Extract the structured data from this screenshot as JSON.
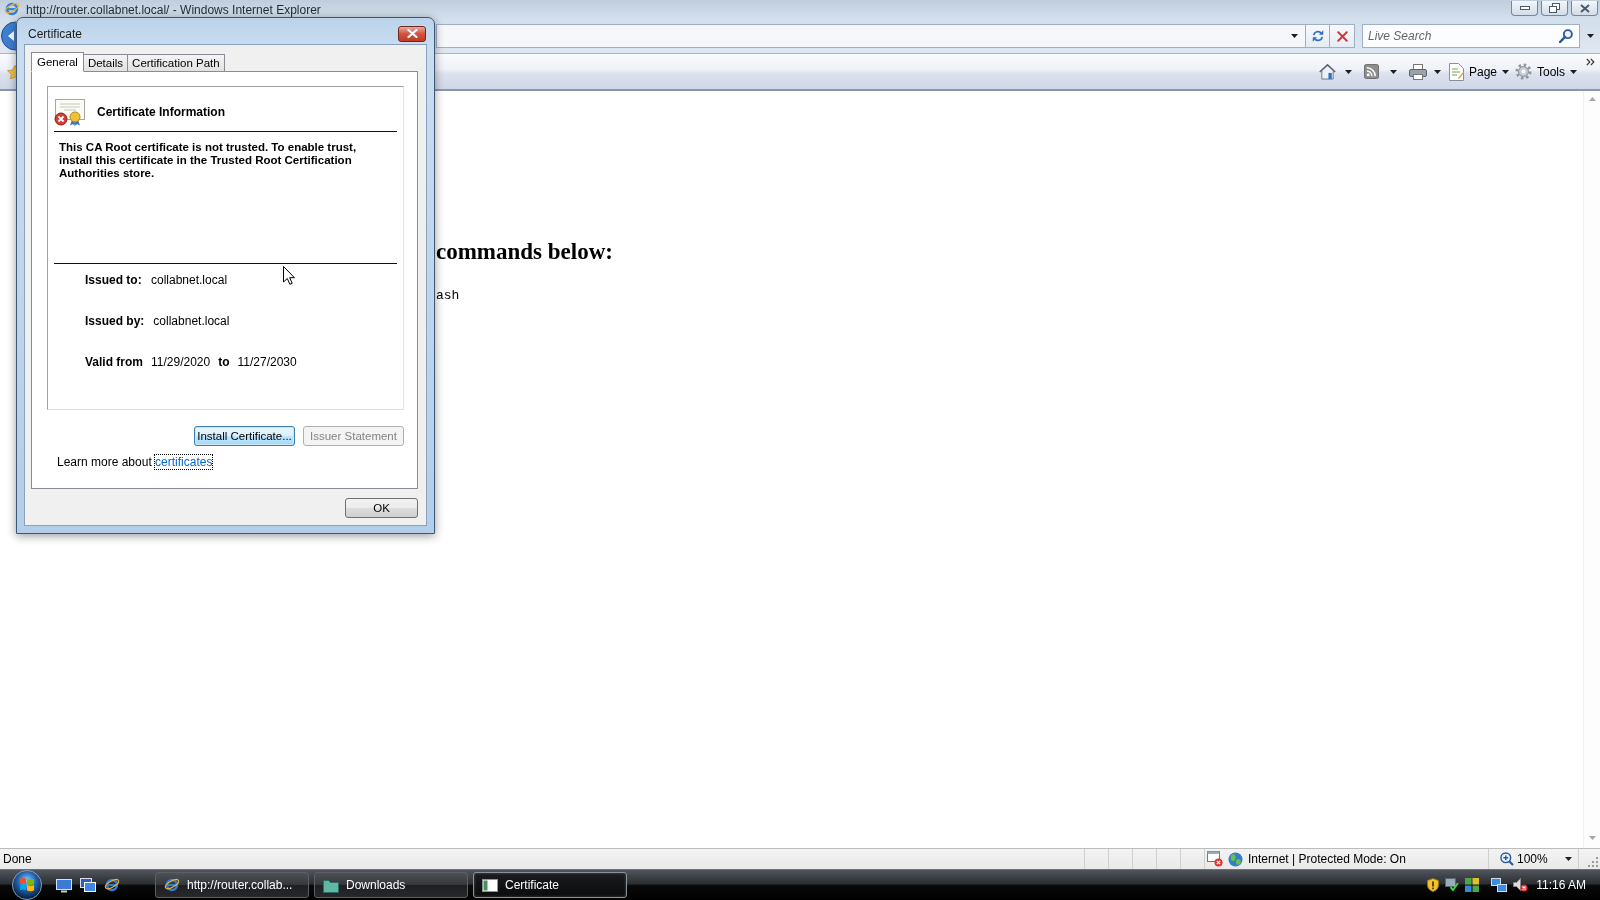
{
  "browser": {
    "title": "http://router.collabnet.local/ - Windows Internet Explorer",
    "search": {
      "placeholder": "Live Search"
    },
    "menus": [
      {
        "kind": "page",
        "label": "Page"
      },
      {
        "kind": "tools",
        "label": "Tools"
      }
    ],
    "page": {
      "heading": "commands below:",
      "code": "ash"
    },
    "status_bar": {
      "text": "Done",
      "zone": "Internet | Protected Mode: On",
      "zoom": "100%"
    }
  },
  "dialog": {
    "title": "Certificate",
    "tabs": [
      {
        "label": "General",
        "selected": true
      },
      {
        "label": "Details",
        "selected": false
      },
      {
        "label": "Certification Path",
        "selected": false
      }
    ],
    "heading": "Certificate Information",
    "message": "This CA Root certificate is not trusted. To enable trust, install this certificate in the Trusted Root Certification Authorities store.",
    "fields": [
      {
        "label": "Issued to:",
        "value": "collabnet.local"
      },
      {
        "label": "Issued by:",
        "value": "collabnet.local"
      }
    ],
    "validity": {
      "label": "Valid from",
      "from": "11/29/2020",
      "separator": "to",
      "to": "11/27/2030"
    },
    "buttons": [
      {
        "label": "Install Certificate...",
        "default": true,
        "disabled": false
      },
      {
        "label": "Issuer Statement",
        "default": false,
        "disabled": true
      }
    ],
    "learn_more": {
      "text": "Learn more about",
      "link": "certificates",
      "focused": true
    },
    "ok_button": "OK"
  },
  "taskbar": {
    "tasks": [
      {
        "kind": "browser",
        "label": "http://router.collab...",
        "selected": false
      },
      {
        "kind": "folder",
        "label": "Downloads",
        "selected": false
      },
      {
        "kind": "dialog",
        "label": "Certificate",
        "selected": true
      }
    ],
    "clock": "11:16 AM"
  }
}
